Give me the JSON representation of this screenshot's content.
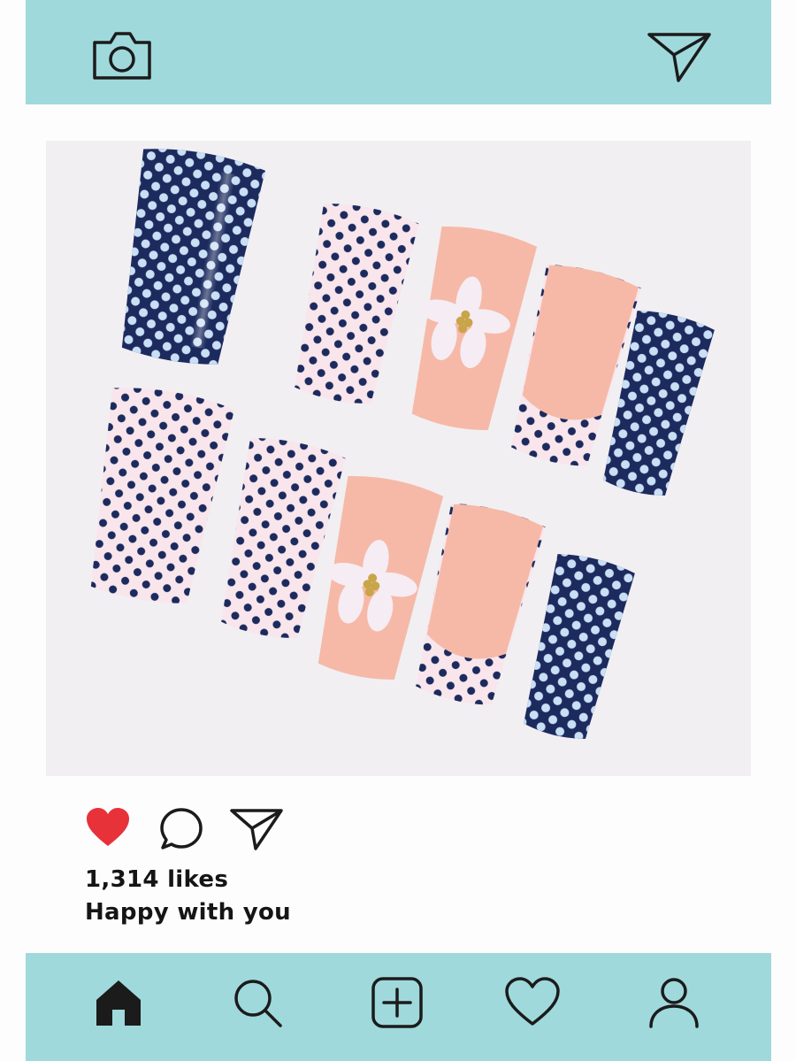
{
  "colors": {
    "bar": "#9fd9dc",
    "icon": "#1b1b1b",
    "like": "#e8323a",
    "navy": "#1c2a5e",
    "blush": "#f8e6ec",
    "nude": "#f6b9a8"
  },
  "header": {
    "left_icon": "camera-icon",
    "right_icon": "paper-plane-icon"
  },
  "post": {
    "image_alt": "Press-on nails: navy and white polka dots, nude nails with white flowers, French-tip nails",
    "action_icons": [
      "heart-filled-icon",
      "comment-icon",
      "share-icon"
    ],
    "likes": "1,314 likes",
    "caption": "Happy with you"
  },
  "bottom_nav": {
    "icons": [
      "home-icon",
      "search-icon",
      "add-post-icon",
      "activity-heart-icon",
      "profile-icon"
    ]
  }
}
